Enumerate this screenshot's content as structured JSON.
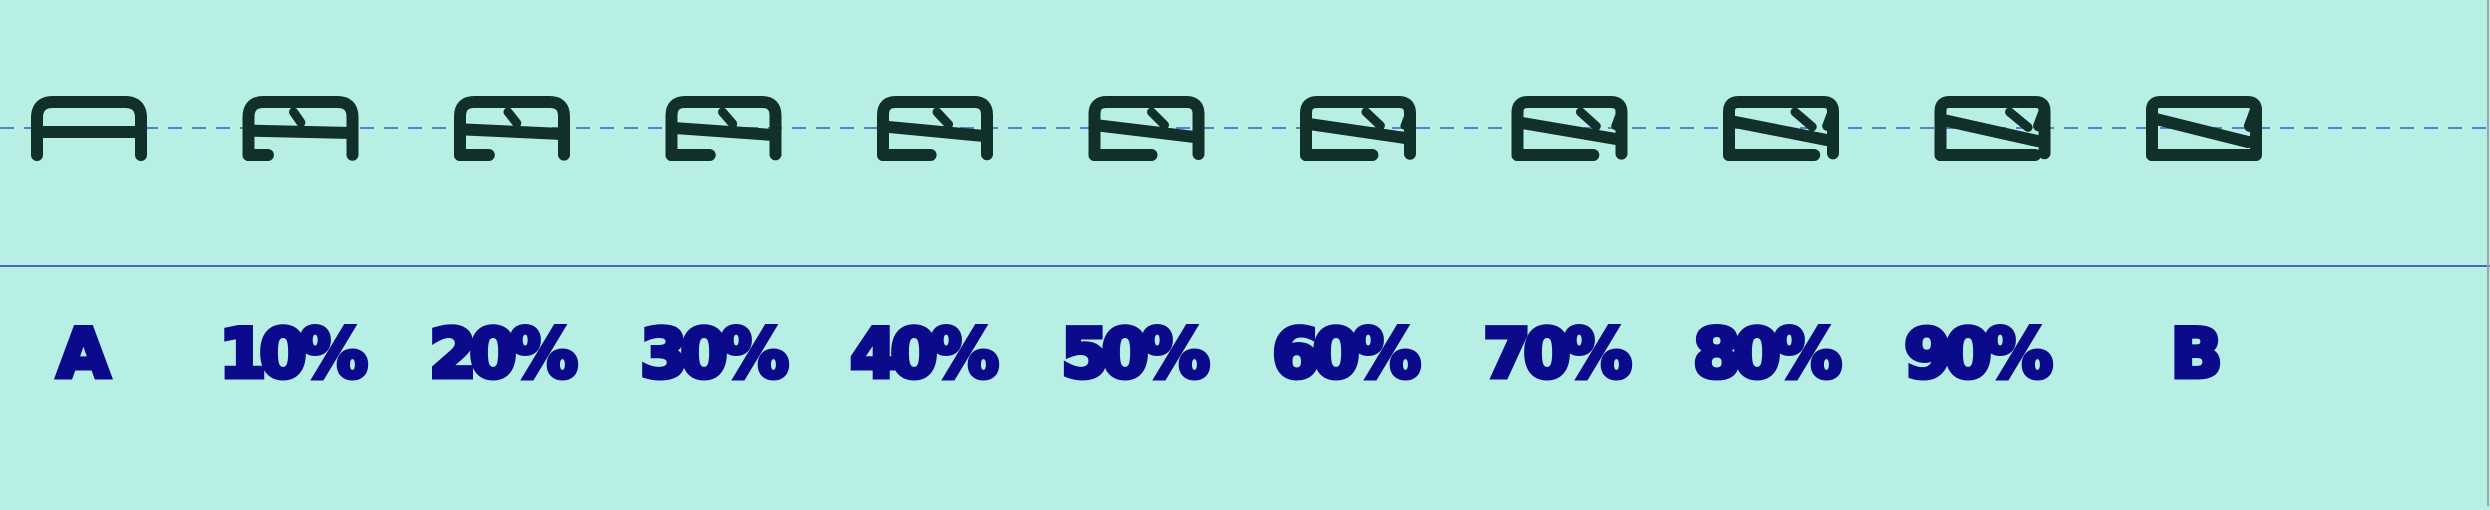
{
  "labels": [
    "A",
    "10%",
    "20%",
    "30%",
    "40%",
    "50%",
    "60%",
    "70%",
    "80%",
    "90%",
    "B"
  ],
  "colors": {
    "background": "#b8efe4",
    "glyph_stroke": "#11302a",
    "label_text": "#0a0a8a",
    "guide_dashed": "#5a7fd0",
    "divider": "#5060c0",
    "frame": "#9aa8a4"
  }
}
